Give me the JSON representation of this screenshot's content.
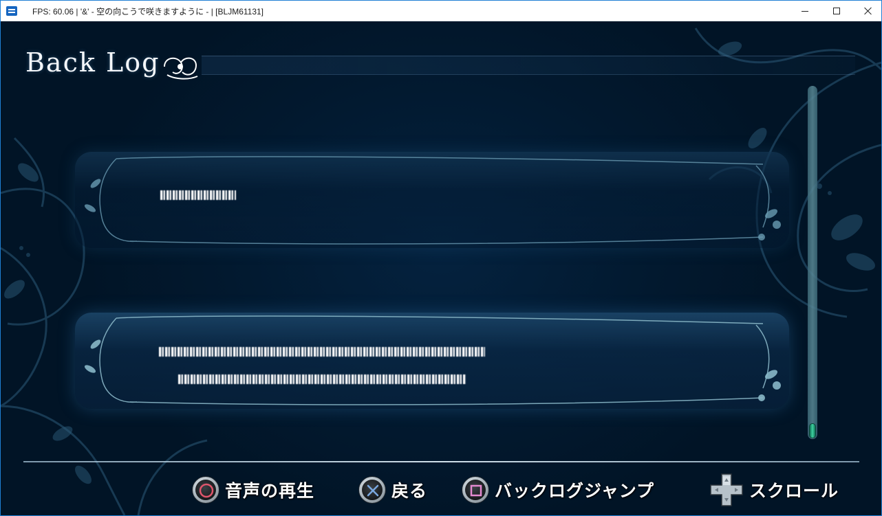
{
  "window": {
    "title": "FPS: 60.06 | '&' - 空の向こうで咲きますように - | [BLJM61131]",
    "icon": "app-icon",
    "controls": [
      "minimize-icon",
      "maximize-icon",
      "close-icon"
    ]
  },
  "screen": {
    "title": "Back Log",
    "title_ornament": "floral-flourish-icon"
  },
  "log": {
    "entries": [
      {
        "lines": [
          "■■■■■…"
        ]
      },
      {
        "lines": [
          "■■■■■■■■ ■■■ ■■■■■■■■■■■■■■■■■■■■■■■",
          "■■ ■■■■■■■■■■■■■■■■■■■■■■■■■■■■■■■"
        ]
      }
    ]
  },
  "scrollbar": {
    "position": 1.0
  },
  "footer": {
    "hints": [
      {
        "button": "circle-button-icon",
        "label": "音声の再生"
      },
      {
        "button": "cross-button-icon",
        "label": "戻る"
      },
      {
        "button": "square-button-icon",
        "label": "バックログジャンプ"
      },
      {
        "button": "dpad-icon",
        "label": "スクロール"
      }
    ]
  },
  "colors": {
    "background": "#00182f",
    "ornament": "#5a8aa0",
    "scroll_thumb": "#3fd0a0",
    "circle": "#e0566c",
    "cross": "#7aa8e0",
    "square": "#e48ad0"
  }
}
